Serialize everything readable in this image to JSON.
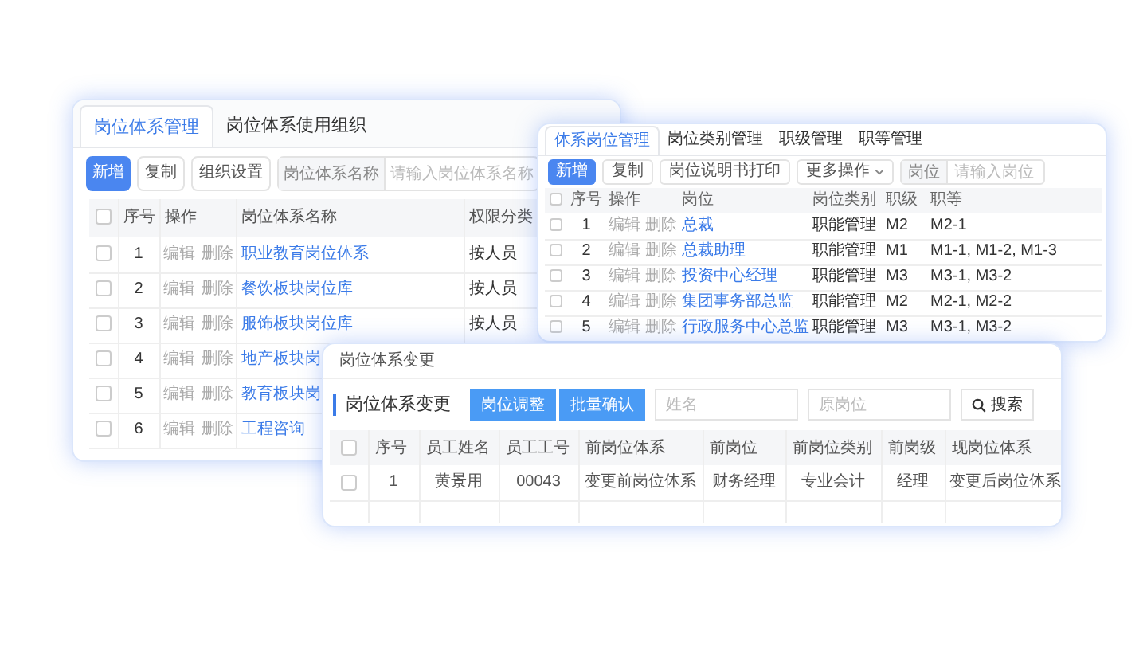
{
  "system_window": {
    "tabs": [
      {
        "label": "岗位体系管理",
        "selected": true
      },
      {
        "label": "岗位体系使用组织",
        "selected": false
      }
    ],
    "toolbar": {
      "buttons": [
        {
          "label": "新增",
          "kind": "primary"
        },
        {
          "label": "复制",
          "kind": "default"
        },
        {
          "label": "组织设置",
          "kind": "default"
        }
      ],
      "search": {
        "label": "岗位体系名称",
        "placeholder": "请输入岗位体系名称"
      }
    },
    "table": {
      "header_checked": false,
      "columns": [
        "序号",
        "操作",
        "岗位体系名称",
        "权限分类"
      ],
      "rows": [
        {
          "checked": false,
          "index": "1",
          "actions": [
            "编辑",
            "删除"
          ],
          "name": "职业教育岗位体系",
          "permission": "按人员"
        },
        {
          "checked": false,
          "index": "2",
          "actions": [
            "编辑",
            "删除"
          ],
          "name": "餐饮板块岗位库",
          "permission": "按人员"
        },
        {
          "checked": false,
          "index": "3",
          "actions": [
            "编辑",
            "删除"
          ],
          "name": "服饰板块岗位库",
          "permission": "按人员"
        },
        {
          "checked": false,
          "index": "4",
          "actions": [
            "编辑",
            "删除"
          ],
          "name": "地产板块岗"
        },
        {
          "checked": false,
          "index": "5",
          "actions": [
            "编辑",
            "删除"
          ],
          "name": "教育板块岗"
        },
        {
          "checked": false,
          "index": "6",
          "actions": [
            "编辑",
            "删除"
          ],
          "name": "工程咨询"
        }
      ]
    }
  },
  "position_window": {
    "tabs": [
      {
        "label": "体系岗位管理",
        "selected": true
      },
      {
        "label": "岗位类别管理",
        "selected": false
      },
      {
        "label": "职级管理",
        "selected": false
      },
      {
        "label": "职等管理",
        "selected": false
      }
    ],
    "toolbar": {
      "buttons": [
        {
          "label": "新增",
          "kind": "primary"
        },
        {
          "label": "复制",
          "kind": "default"
        },
        {
          "label": "岗位说明书打印",
          "kind": "default"
        },
        {
          "label": "更多操作",
          "kind": "dropdown"
        }
      ],
      "search": {
        "label": "岗位",
        "placeholder": "请输入岗位"
      }
    },
    "table": {
      "header_checked": false,
      "columns": [
        "序号",
        "操作",
        "岗位",
        "岗位类别",
        "职级",
        "职等"
      ],
      "rows": [
        {
          "checked": false,
          "index": "1",
          "actions": [
            "编辑",
            "删除"
          ],
          "position": "总裁",
          "category": "职能管理",
          "level": "M2",
          "grades": "M2-1"
        },
        {
          "checked": false,
          "index": "2",
          "actions": [
            "编辑",
            "删除"
          ],
          "position": "总裁助理",
          "category": "职能管理",
          "level": "M1",
          "grades": "M1-1, M1-2, M1-3"
        },
        {
          "checked": false,
          "index": "3",
          "actions": [
            "编辑",
            "删除"
          ],
          "position": "投资中心经理",
          "category": "职能管理",
          "level": "M3",
          "grades": "M3-1, M3-2"
        },
        {
          "checked": false,
          "index": "4",
          "actions": [
            "编辑",
            "删除"
          ],
          "position": "集团事务部总监",
          "category": "职能管理",
          "level": "M2",
          "grades": "M2-1, M2-2"
        },
        {
          "checked": false,
          "index": "5",
          "actions": [
            "编辑",
            "删除"
          ],
          "position": "行政服务中心总监",
          "category": "职能管理",
          "level": "M3",
          "grades": "M3-1, M3-2"
        }
      ]
    }
  },
  "change_window": {
    "title": "岗位体系变更",
    "heading": "岗位体系变更",
    "buttons": [
      "岗位调整",
      "批量确认"
    ],
    "fields": [
      {
        "placeholder": "姓名"
      },
      {
        "placeholder": "原岗位"
      }
    ],
    "search_button": "搜索",
    "table": {
      "header_checked": false,
      "columns": [
        "序号",
        "员工姓名",
        "员工工号",
        "前岗位体系",
        "前岗位",
        "前岗位类别",
        "前岗级",
        "现岗位体系"
      ],
      "rows": [
        {
          "checked": false,
          "cells": [
            "1",
            "黄景用",
            "00043",
            "变更前岗位体系",
            "财务经理",
            "专业会计",
            "经理",
            "变更后岗位体系"
          ]
        }
      ]
    }
  }
}
